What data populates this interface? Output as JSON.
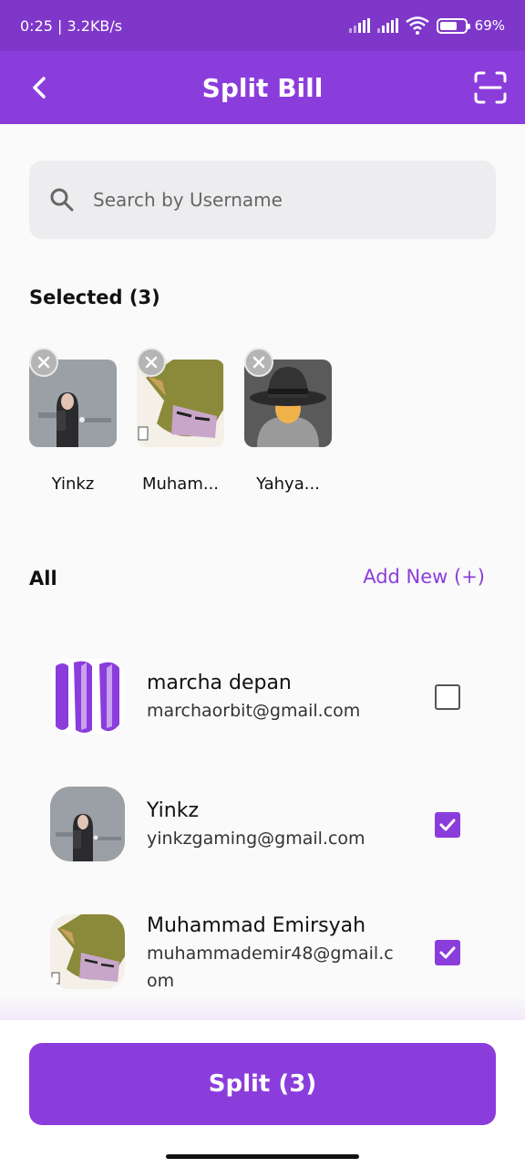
{
  "status": {
    "time": "0:25 | 3.2KB/s",
    "battery": "69%",
    "battery_level": 0.69
  },
  "appbar": {
    "title": "Split Bill",
    "back_icon": "chevron-left-icon",
    "scan_icon": "scan-icon"
  },
  "search": {
    "placeholder": "Search by Username",
    "icon": "search-icon"
  },
  "selected": {
    "heading": "Selected (3)",
    "items": [
      {
        "name": "Yinkz"
      },
      {
        "name": "Muham..."
      },
      {
        "name": "Yahya..."
      }
    ]
  },
  "all": {
    "heading": "All",
    "add_new": "Add New (+)",
    "items": [
      {
        "username": "marcha depan",
        "email": "marchaorbit@gmail.com",
        "checked": false
      },
      {
        "username": "Yinkz",
        "email": "yinkzgaming@gmail.com",
        "checked": true
      },
      {
        "username": "Muhammad Emirsyah",
        "email": "muhammademir48@gmail.com",
        "checked": true
      }
    ]
  },
  "split_button": "Split (3)",
  "colors": {
    "primary": "#8b3ddc",
    "status_bar": "#7e37c9",
    "search_bg": "#ededf0"
  }
}
